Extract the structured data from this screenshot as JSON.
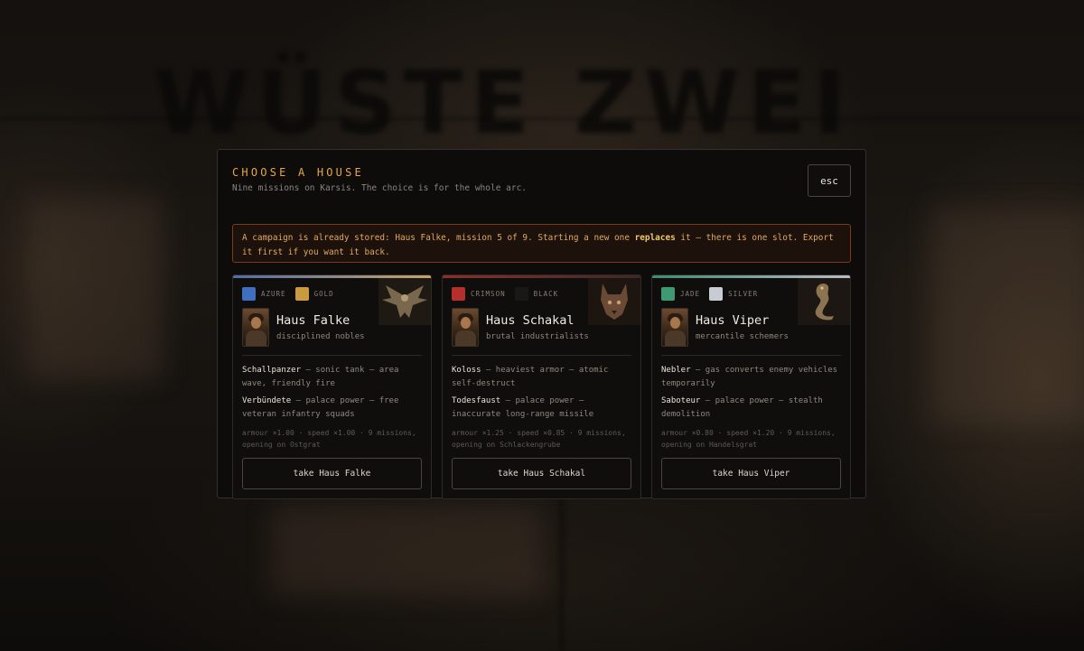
{
  "backdrop": {
    "title": "WÜSTE ZWEI"
  },
  "modal": {
    "title": "CHOOSE A HOUSE",
    "subtitle": "Nine missions on Karsis. The choice is for the whole arc.",
    "close_label": "esc",
    "warning": {
      "before": "A campaign is already stored: Haus Falke, mission 5 of 9. Starting a new one ",
      "emphasis": "replaces",
      "after": " it — there is one slot. Export it first if you want it back."
    }
  },
  "houses": [
    {
      "accent": "#4f6fa8",
      "emblem_icon": "eagle-icon",
      "colors": [
        {
          "label": "AZURE",
          "hex": "#3f6fbf"
        },
        {
          "label": "GOLD",
          "hex": "#c99a3e"
        }
      ],
      "name": "Haus Falke",
      "tagline": "disciplined nobles",
      "units": [
        {
          "name": "Schallpanzer",
          "desc": " — sonic tank — area wave, friendly fire"
        },
        {
          "name": "Verbündete",
          "desc": " — palace power — free veteran infantry squads"
        }
      ],
      "stats": "armour ×1.00 · speed ×1.00 · 9 missions, opening on Ostgrat",
      "button_label": "take Haus Falke"
    },
    {
      "accent": "#8c2f2a",
      "emblem_icon": "jackal-icon",
      "colors": [
        {
          "label": "CRIMSON",
          "hex": "#b5302c"
        },
        {
          "label": "BLACK",
          "hex": "#1a1816"
        }
      ],
      "name": "Haus Schakal",
      "tagline": "brutal industrialists",
      "units": [
        {
          "name": "Koloss",
          "desc": " — heaviest armor — atomic self-destruct"
        },
        {
          "name": "Todesfaust",
          "desc": " — palace power — inaccurate long-range missile"
        }
      ],
      "stats": "armour ×1.25 · speed ×0.85 · 9 missions, opening on Schlackengrube",
      "button_label": "take Haus Schakal"
    },
    {
      "accent": "#3c8c76",
      "emblem_icon": "cobra-icon",
      "colors": [
        {
          "label": "JADE",
          "hex": "#3e9a73"
        },
        {
          "label": "SILVER",
          "hex": "#c8cbd2"
        }
      ],
      "name": "Haus Viper",
      "tagline": "mercantile schemers",
      "units": [
        {
          "name": "Nebler",
          "desc": " — gas converts enemy vehicles temporarily"
        },
        {
          "name": "Saboteur",
          "desc": " — palace power — stealth demolition"
        }
      ],
      "stats": "armour ×0.80 · speed ×1.20 · 9 missions, opening on Handelsgrat",
      "button_label": "take Haus Viper"
    }
  ]
}
